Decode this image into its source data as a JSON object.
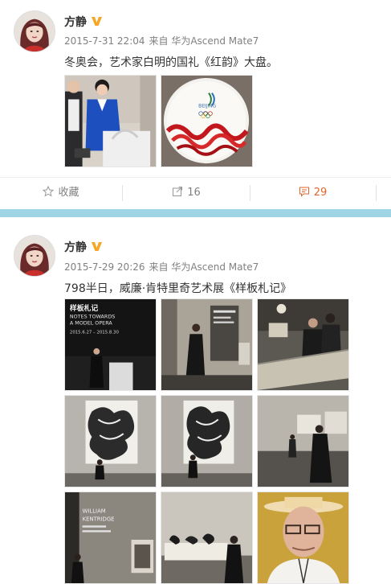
{
  "colors": {
    "divider": "#9fd4e5",
    "comment_accent": "#e0652c",
    "verified_badge": "#f5a623",
    "meta_gray": "#808080"
  },
  "posts": [
    {
      "author": "方静",
      "time": "2015-7-31 22:04",
      "source": "来自 华为Ascend Mate7",
      "text": "冬奥会，艺术家白明的国礼《红韵》大盘。",
      "actions": {
        "favorite_label": "收藏",
        "forward_count": "16",
        "comment_count": "29"
      }
    },
    {
      "author": "方静",
      "time": "2015-7-29 20:26",
      "source": "来自 华为Ascend Mate7",
      "text": "798半日，威廉·肯特里奇艺术展《样板札记》",
      "poster": {
        "title_cn": "样板札记",
        "title_en_1": "NOTES TOWARDS",
        "title_en_2": "A MODEL OPERA",
        "dates": "2015.6.27 – 2015.8.30"
      },
      "wall": {
        "line1": "WILLIAM",
        "line2": "KENTRIDGE"
      }
    }
  ]
}
